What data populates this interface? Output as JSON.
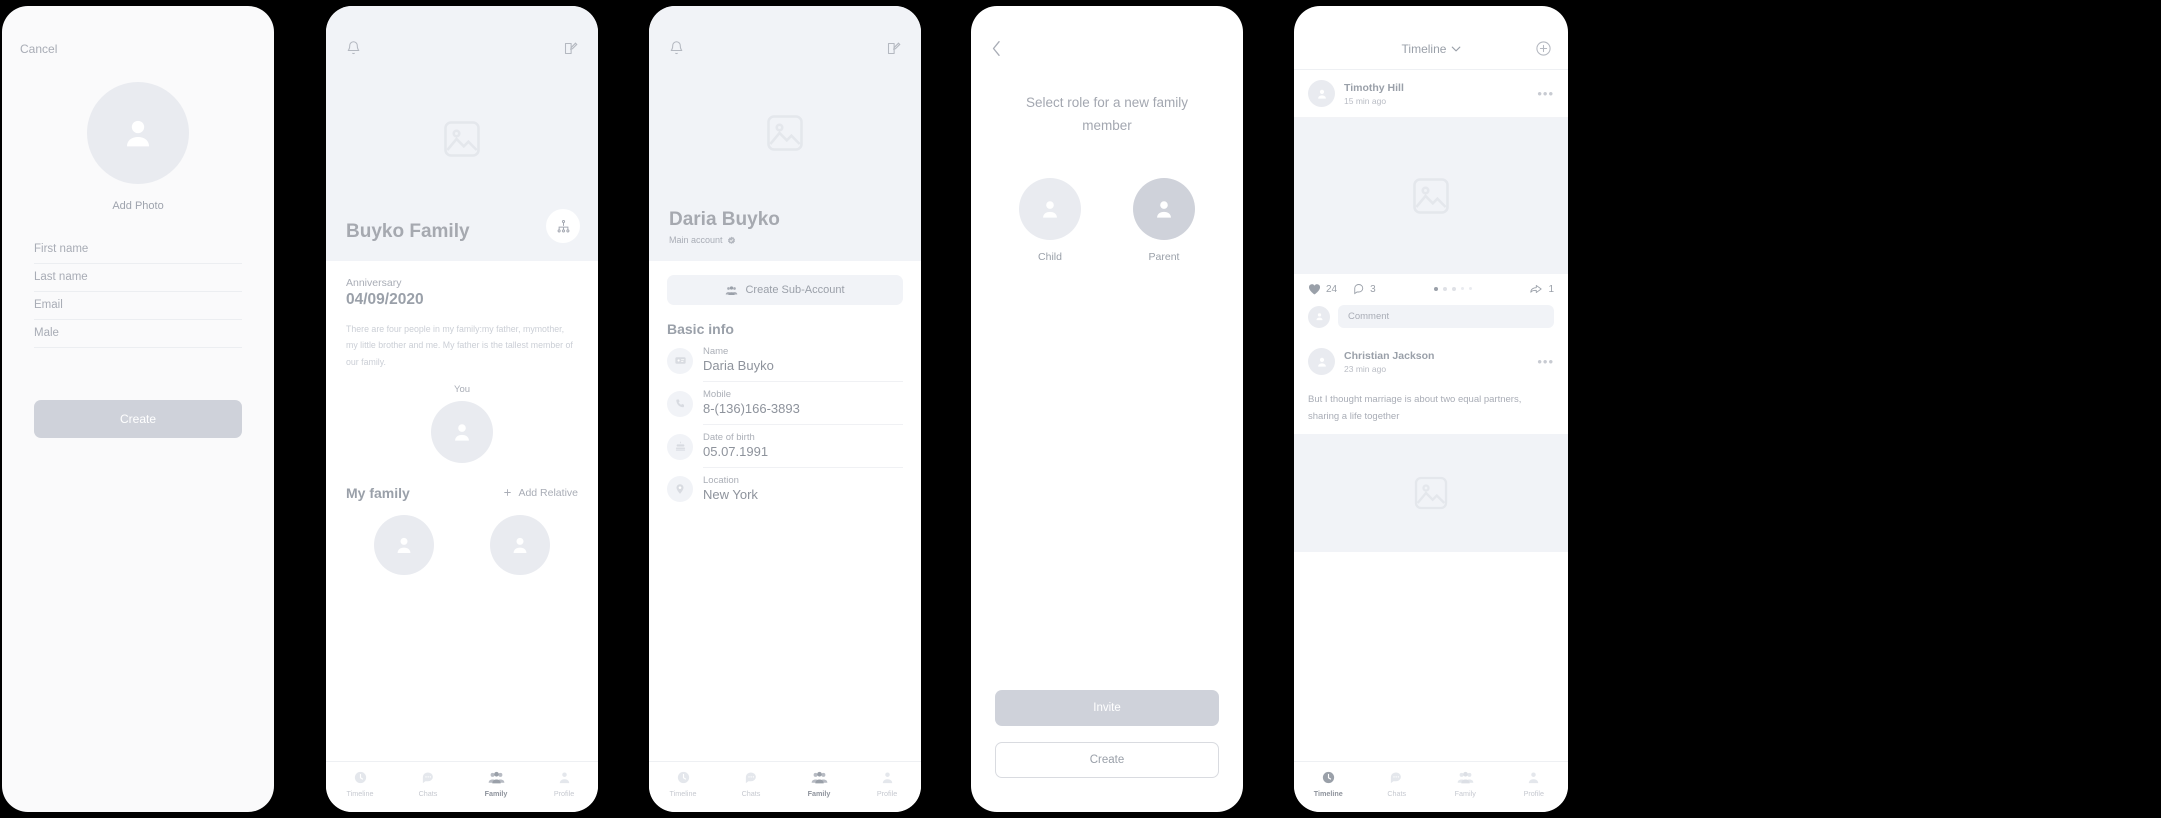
{
  "screen1": {
    "cancel_label": "Cancel",
    "add_photo_label": "Add Photo",
    "fields": [
      {
        "name": "first-name",
        "placeholder": "First name"
      },
      {
        "name": "last-name",
        "placeholder": "Last name"
      },
      {
        "name": "email",
        "placeholder": "Email"
      },
      {
        "name": "gender",
        "placeholder": "Male"
      }
    ],
    "create_label": "Create"
  },
  "screen2": {
    "family_name": "Buyko Family",
    "anniversary_label": "Anniversary",
    "anniversary_date": "04/09/2020",
    "description": "There are four people in my family:my father, mymother, my little brother and me. My father is the tallest member of our family.",
    "you_label": "You",
    "my_family_label": "My family",
    "add_relative_label": "Add Relative",
    "tabs": [
      {
        "label": "Timeline",
        "active": false
      },
      {
        "label": "Chats",
        "active": false
      },
      {
        "label": "Family",
        "active": true
      },
      {
        "label": "Profile",
        "active": false
      }
    ]
  },
  "screen3": {
    "person_name": "Daria Buyko",
    "account_type": "Main account",
    "create_subaccount_label": "Create Sub-Account",
    "basic_info_label": "Basic info",
    "rows": [
      {
        "icon": "id-card-icon",
        "label": "Name",
        "value": "Daria Buyko"
      },
      {
        "icon": "phone-icon",
        "label": "Mobile",
        "value": "8-(136)166-3893"
      },
      {
        "icon": "cake-icon",
        "label": "Date of birth",
        "value": "05.07.1991"
      },
      {
        "icon": "pin-icon",
        "label": "Location",
        "value": "New York"
      }
    ],
    "tabs": [
      {
        "label": "Timeline",
        "active": false
      },
      {
        "label": "Chats",
        "active": false
      },
      {
        "label": "Family",
        "active": true
      },
      {
        "label": "Profile",
        "active": false
      }
    ]
  },
  "screen4": {
    "question": "Select role for a new family member",
    "roles": [
      {
        "label": "Child",
        "selected": false
      },
      {
        "label": "Parent",
        "selected": true
      }
    ],
    "invite_label": "Invite",
    "create_label": "Create"
  },
  "screen5": {
    "title": "Timeline",
    "posts": [
      {
        "author": "Timothy Hill",
        "time": "15 min ago",
        "likes": "24",
        "comments": "3",
        "shares": "1",
        "pager_count": 5,
        "pager_active": 0,
        "comment_placeholder": "Comment",
        "body": ""
      },
      {
        "author": "Christian Jackson",
        "time": "23 min ago",
        "body": "But I thought marriage is about two equal partners, sharing a life together"
      }
    ],
    "tabs": [
      {
        "label": "Timeline",
        "active": true
      },
      {
        "label": "Chats",
        "active": false
      },
      {
        "label": "Family",
        "active": false
      },
      {
        "label": "Profile",
        "active": false
      }
    ]
  },
  "colors": {
    "bg": "#000000",
    "card": "#ffffff",
    "hero": "#f1f3f7",
    "accent_disabled": "#cfd2da",
    "text_muted": "#a9adb6"
  }
}
